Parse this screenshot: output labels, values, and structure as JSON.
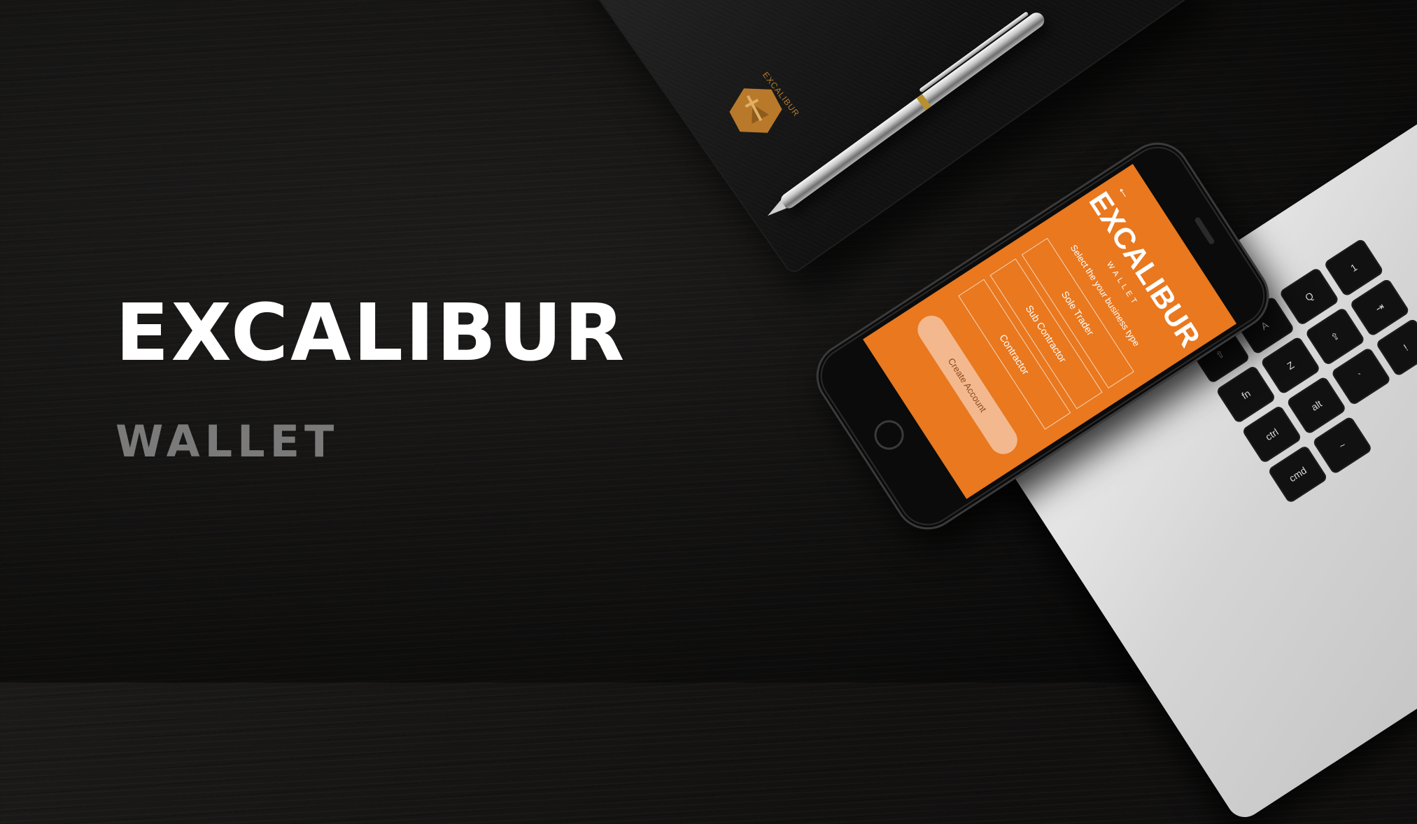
{
  "hero": {
    "title": "EXCALIBUR",
    "subtitle": "WALLET"
  },
  "notebook": {
    "brand": "EXCALIBUR"
  },
  "app": {
    "logo": "EXCALIBUR",
    "logo_sub": "WALLET",
    "back": "←",
    "prompt": "Select the your business type",
    "options": [
      "Sole Trader",
      "Sub Contractor",
      "Contractor"
    ],
    "create_button": "Create Account"
  },
  "keyboard": {
    "keys": [
      "fn",
      "ctrl",
      "alt",
      "cmd",
      "⇧",
      "A",
      "Z",
      "⇪",
      "Q",
      "⇥",
      "`",
      "~",
      "1",
      "!"
    ]
  },
  "colors": {
    "accent": "#e9781f",
    "background": "#141312",
    "title": "#ffffff",
    "subtitle": "#7a7a7a"
  }
}
